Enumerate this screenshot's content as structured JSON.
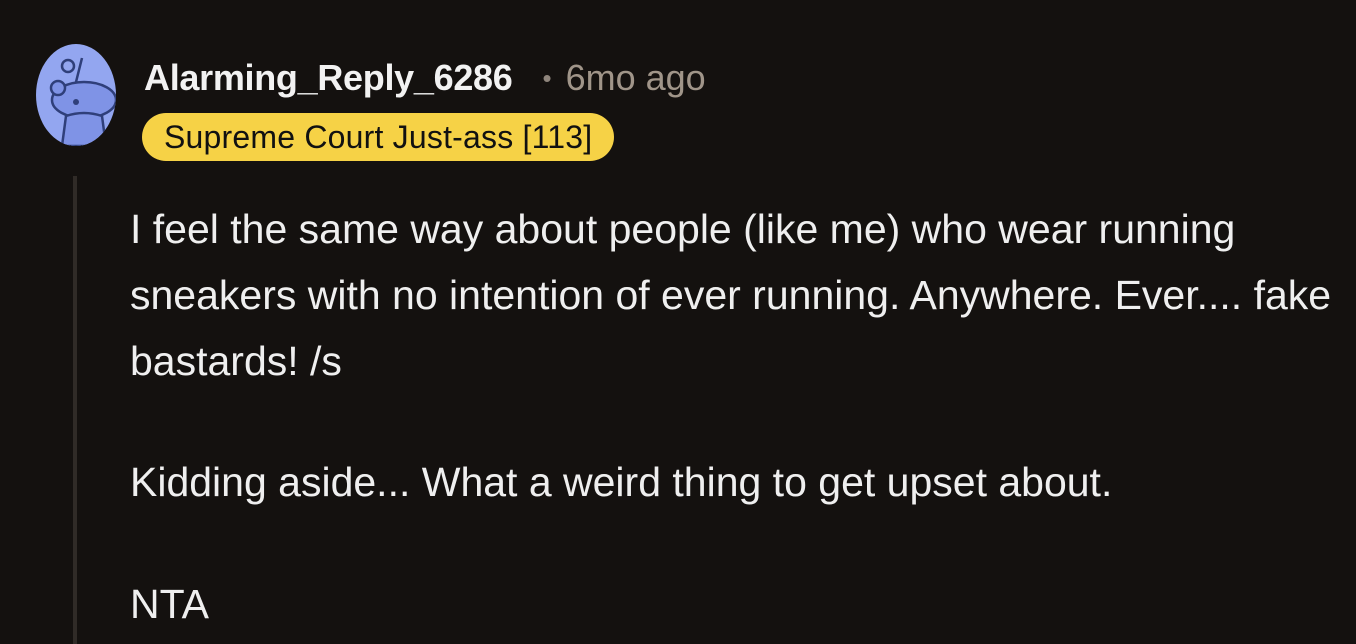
{
  "comment": {
    "author": "Alarming_Reply_6286",
    "separator": "•",
    "timestamp": "6mo ago",
    "flair": "Supreme Court Just-ass [113]",
    "body": {
      "line1": "I feel the same way about people (like me) who wear running sneakers with no intention of ever running. Anywhere. Ever.... fake bastards! /s",
      "line2": "Kidding aside... What a weird thing to get upset about.",
      "line3": "NTA"
    },
    "avatar_icon": "snoo-avatar-icon",
    "colors": {
      "background": "#14110f",
      "flair_bg": "#f6d246",
      "avatar_bg": "#93a6f0",
      "text": "#efefef",
      "meta": "#a09589"
    }
  }
}
